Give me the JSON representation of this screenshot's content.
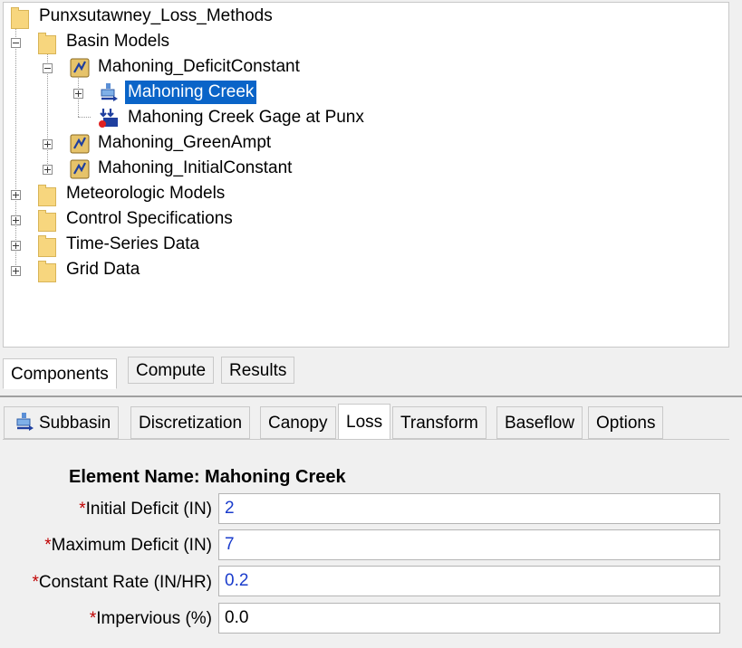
{
  "tree": {
    "root": "Punxsutawney_Loss_Methods",
    "basin_models": "Basin Models",
    "basin1": "Mahoning_DeficitConstant",
    "subbasin": "Mahoning Creek",
    "gage": "Mahoning Creek Gage at Punx",
    "basin2": "Mahoning_GreenAmpt",
    "basin3": "Mahoning_InitialConstant",
    "met": "Meteorologic Models",
    "control": "Control Specifications",
    "ts": "Time-Series Data",
    "grid": "Grid Data"
  },
  "top_tabs": [
    "Components",
    "Compute",
    "Results"
  ],
  "bottom_tabs": [
    "Subbasin",
    "Discretization",
    "Canopy",
    "Loss",
    "Transform",
    "Baseflow",
    "Options"
  ],
  "form": {
    "element_name": "Element Name: Mahoning Creek",
    "required_mark": "*",
    "fields": [
      {
        "label": "Initial Deficit (IN)",
        "value": "2"
      },
      {
        "label": "Maximum Deficit (IN)",
        "value": "7"
      },
      {
        "label": "Constant Rate (IN/HR)",
        "value": "0.2"
      },
      {
        "label": "Impervious (%)",
        "value": "0.0"
      }
    ]
  },
  "colors": {
    "selection": "#0a64c8",
    "required": "#c00000",
    "value_text": "#1a3ccc"
  },
  "icons": [
    "folder-icon",
    "basin-model-icon",
    "subbasin-icon",
    "sink-icon",
    "expand-icon",
    "collapse-icon"
  ]
}
